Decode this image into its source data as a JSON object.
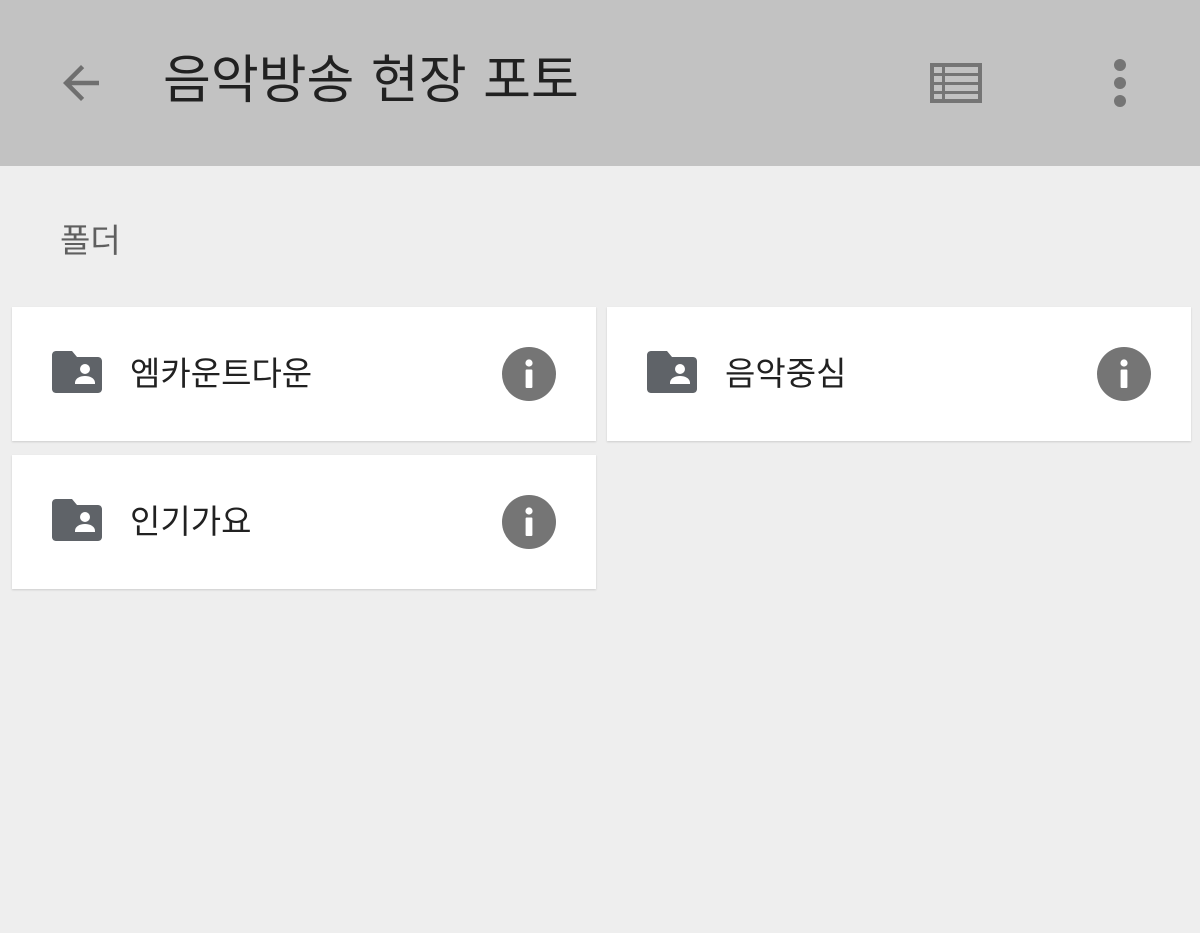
{
  "header": {
    "title": "음악방송 현장 포토",
    "back_icon": "arrow-back-icon",
    "list_view_icon": "view-list-icon",
    "more_icon": "more-vert-icon"
  },
  "section": {
    "label": "폴더"
  },
  "folders": [
    {
      "name": "엠카운트다운",
      "icon": "shared-folder-icon",
      "info_icon": "info-icon"
    },
    {
      "name": "음악중심",
      "icon": "shared-folder-icon",
      "info_icon": "info-icon"
    },
    {
      "name": "인기가요",
      "icon": "shared-folder-icon",
      "info_icon": "info-icon"
    }
  ],
  "colors": {
    "app_bar": "#c2c2c2",
    "background": "#eeeeee",
    "icon": "#757575",
    "folder_icon": "#5f6368"
  }
}
